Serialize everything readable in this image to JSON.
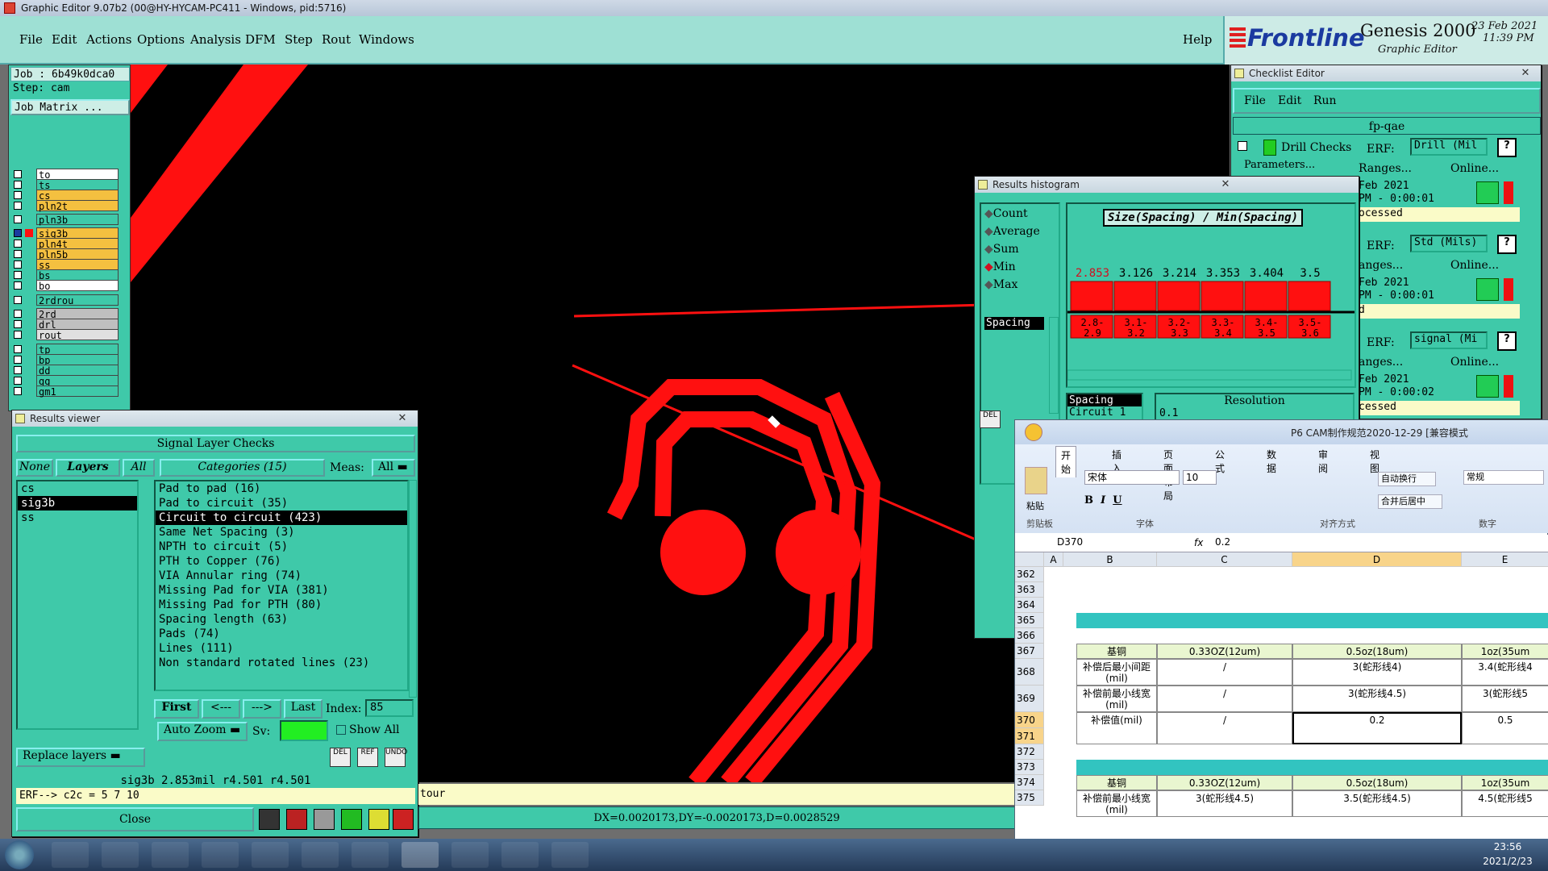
{
  "window_title": "Graphic Editor 9.07b2 (00@HY-HYCAM-PC411 - Windows, pid:5716)",
  "menu": [
    "File",
    "Edit",
    "Actions",
    "Options",
    "Analysis",
    "DFM",
    "Step",
    "Rout",
    "Windows"
  ],
  "menu_help": "Help",
  "logo": {
    "brand": "Frontline",
    "product": "Genesis 2000",
    "subtitle": "Graphic Editor",
    "date": "23 Feb 2021",
    "time": "11:39 PM"
  },
  "job": {
    "job_label": "Job : 6b49k0dca0",
    "step_label": "Step: cam",
    "matrix_button": "Job Matrix ..."
  },
  "layers": [
    {
      "name": "to",
      "color": "#ffffff"
    },
    {
      "name": "ts",
      "color": "#3fc9a9"
    },
    {
      "name": "cs",
      "color": "#f4c040"
    },
    {
      "name": "pln2t",
      "color": "#f4c040"
    },
    {
      "name": "pln3b",
      "color": "#3fc9a9"
    },
    {
      "name": "sig3b",
      "color": "#f4c040"
    },
    {
      "name": "pln4t",
      "color": "#f4c040"
    },
    {
      "name": "pln5b",
      "color": "#f4c040"
    },
    {
      "name": "ss",
      "color": "#f4c040"
    },
    {
      "name": "bs",
      "color": "#3fc9a9"
    },
    {
      "name": "bo",
      "color": "#ffffff"
    },
    {
      "name": "2rdrou",
      "color": "#3fc9a9"
    },
    {
      "name": "2rd",
      "color": "#bfbfbf"
    },
    {
      "name": "drl",
      "color": "#bfbfbf"
    },
    {
      "name": "rout",
      "color": "#e0e0e0"
    },
    {
      "name": "tp",
      "color": "#3fc9a9"
    },
    {
      "name": "bp",
      "color": "#3fc9a9"
    },
    {
      "name": "dd",
      "color": "#3fc9a9"
    },
    {
      "name": "gg",
      "color": "#3fc9a9"
    },
    {
      "name": "gm1",
      "color": "#3fc9a9"
    }
  ],
  "results_viewer": {
    "title": "Results viewer",
    "header": "Signal Layer Checks",
    "none_btn": "None",
    "layers_btn": "Layers",
    "all_btn": "All",
    "categories_label": "Categories (15)",
    "meas_label": "Meas:",
    "meas_value": "All",
    "layer_list": [
      "cs",
      "sig3b",
      "ss"
    ],
    "categories": [
      "Pad to pad (16)",
      "Pad to circuit (35)",
      "Circuit to circuit (423)",
      "Same Net Spacing (3)",
      "NPTH to circuit (5)",
      "PTH to Copper (76)",
      "VIA Annular ring (74)",
      "Missing Pad for VIA (381)",
      "Missing Pad for PTH (80)",
      "Spacing length (63)",
      "Pads (74)",
      "Lines (111)",
      "Non standard rotated lines (23)"
    ],
    "nav": {
      "first": "First",
      "prev": "<---",
      "next": "--->",
      "last": "Last",
      "index_label": "Index:",
      "index_value": "85"
    },
    "auto_zoom": "Auto Zoom",
    "sv_label": "Sv:",
    "show_all": "Show All",
    "replace_layers": "Replace layers",
    "status": "sig3b 2.853mil  r4.501  r4.501",
    "erf": "ERF--> c2c = 5 7 10",
    "close": "Close"
  },
  "histogram": {
    "title": "Results histogram",
    "modes": [
      "Count",
      "Average",
      "Sum",
      "Min",
      "Max"
    ],
    "selected_mode": "Min",
    "metric": "Spacing",
    "header": "Size(Spacing) / Min(Spacing)",
    "resolution_label": "Resolution",
    "resolution_value": "0.1",
    "list": [
      "Spacing",
      "Circuit 1"
    ],
    "chart_data": {
      "type": "bar",
      "categories": [
        "2.8-2.9",
        "3.1-3.2",
        "3.2-3.3",
        "3.3-3.4",
        "3.4-3.5",
        "3.5-3.6"
      ],
      "values": [
        2.853,
        3.126,
        3.214,
        3.353,
        3.404,
        3.5
      ],
      "value_labels": [
        "2.853",
        "3.126",
        "3.214",
        "3.353",
        "3.404",
        "3.5"
      ]
    }
  },
  "checklist": {
    "title": "Checklist Editor",
    "menu": [
      "File",
      "Edit",
      "Run"
    ],
    "name": "fp-qae",
    "rows": [
      {
        "name": "Drill Checks",
        "erf_label": "ERF:",
        "erf": "Drill (Mil",
        "ranges": "Ranges...",
        "online": "Online...",
        "date": "Feb 2021",
        "time": "PM - 0:00:01",
        "status": "ocessed"
      },
      {
        "name": "",
        "erf_label": "ERF:",
        "erf": "Std (Mils)",
        "ranges": "anges...",
        "online": "Online...",
        "date": "Feb 2021",
        "time": "PM - 0:00:01",
        "status": "d"
      },
      {
        "name": "",
        "erf_label": "ERF:",
        "erf": "signal (Mi",
        "ranges": "anges...",
        "online": "Online...",
        "date": "Feb 2021",
        "time": "PM - 0:00:02",
        "status": "cessed"
      }
    ],
    "params": "Parameters..."
  },
  "excel": {
    "title": "P6 CAM制作规范2020-12-29 [兼容模式",
    "tabs": [
      "开始",
      "插入",
      "页面布局",
      "公式",
      "数据",
      "审阅",
      "视图"
    ],
    "font_name": "宋体",
    "font_size": "10",
    "wrap": "自动换行",
    "merge": "合并后居中",
    "number_format": "常规",
    "groups": [
      "剪贴板",
      "字体",
      "对齐方式",
      "数字"
    ],
    "paste": "粘贴",
    "cell_ref": "D370",
    "formula": "0.2",
    "columns": [
      "A",
      "B",
      "C",
      "D",
      "E"
    ],
    "rows": [
      "362",
      "363",
      "364",
      "365",
      "366",
      "367",
      "368",
      "369",
      "370",
      "371",
      "372",
      "373",
      "374",
      "375"
    ],
    "table1": {
      "header": [
        "基铜",
        "0.33OZ(12um)",
        "0.5oz(18um)",
        "1oz(35um"
      ],
      "r1": [
        "补偿后最小间距(mil)",
        "/",
        "3(蛇形线4)",
        "3.4(蛇形线4"
      ],
      "r2": [
        "补偿前最小线宽(mil)",
        "/",
        "3(蛇形线4.5)",
        "3(蛇形线5"
      ],
      "r3": [
        "补偿值(mil)",
        "/",
        "0.2",
        "0.5"
      ]
    },
    "table2": {
      "header": [
        "基铜",
        "0.33OZ(12um)",
        "0.5oz(18um)",
        "1oz(35um"
      ],
      "r1": [
        "补偿前最小线宽(mil)",
        "3(蛇形线4.5)",
        "3.5(蛇形线4.5)",
        "4.5(蛇形线5"
      ]
    }
  },
  "bottom_status": {
    "coords": "DX=0.0020173,DY=-0.0020173,D=0.0028529",
    "tour": "tour"
  },
  "clock": {
    "time": "23:56",
    "date": "2021/2/23"
  },
  "colors": {
    "teal": "#3fc9a9",
    "red": "#ff1010",
    "canvas": "#000000"
  }
}
